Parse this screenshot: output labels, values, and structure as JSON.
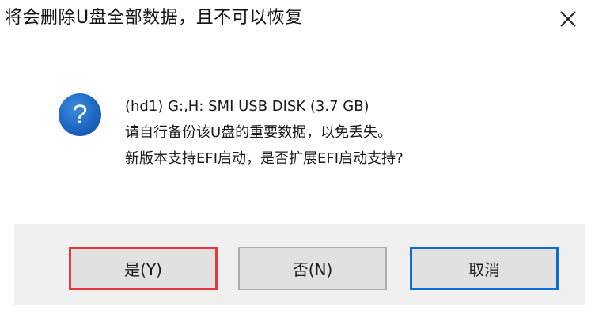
{
  "dialog": {
    "title": "将会删除U盘全部数据，且不可以恢复",
    "close_icon": "close-icon",
    "question_icon": "question-icon",
    "message_lines": [
      "(hd1) G:,H: SMI USB DISK (3.7 GB)",
      "请自行备份该U盘的重要数据，以免丢失。",
      "新版本支持EFI启动，是否扩展EFI启动支持?"
    ],
    "buttons": {
      "yes": "是(Y)",
      "no": "否(N)",
      "cancel": "取消"
    },
    "colors": {
      "highlight_border": "#e53935",
      "focus_border": "#0a6cd6",
      "question_icon_fill": "#1565c0"
    }
  }
}
